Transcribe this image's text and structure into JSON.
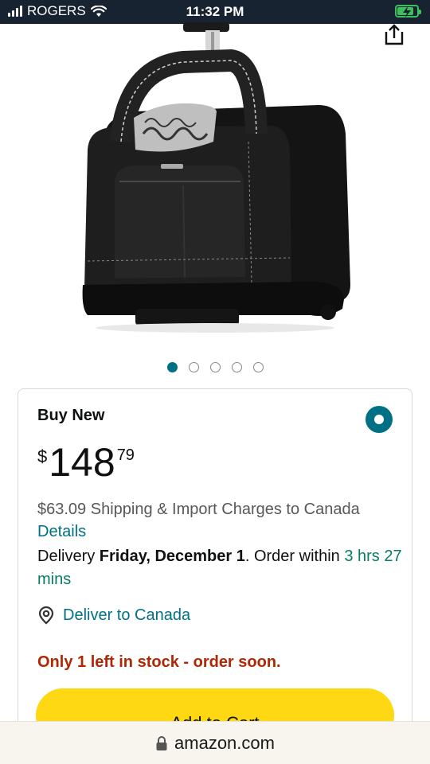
{
  "status_bar": {
    "carrier": "ROGERS",
    "time": "11:32 PM",
    "battery_level": 0.85,
    "signal_icon": "signal-bars-icon",
    "wifi_icon": "wifi-icon",
    "battery_icon": "battery-charging-icon"
  },
  "header": {
    "share_icon": "share-icon"
  },
  "gallery": {
    "image_count": 5,
    "active_index": 0
  },
  "buy_box": {
    "title": "Buy New",
    "price_symbol": "$",
    "price_whole": "148",
    "price_fraction": "79",
    "shipping_text": "$63.09 Shipping & Import Charges to Canada",
    "details_link": "Details",
    "delivery_prefix": "Delivery ",
    "delivery_date": "Friday, December 1",
    "delivery_mid": ". Order within ",
    "delivery_countdown": "3 hrs 27 mins",
    "deliver_to": "Deliver to Canada",
    "stock_text": "Only 1 left in stock - order soon.",
    "add_to_cart": "Add to Cart"
  },
  "url_bar": {
    "url": "amazon.com",
    "lock_icon": "lock-icon"
  },
  "colors": {
    "status_bar_bg": "#172331",
    "link_teal": "#007185",
    "stock_red": "#b12704",
    "countdown_green": "#067d62",
    "cart_yellow": "#ffd814"
  }
}
